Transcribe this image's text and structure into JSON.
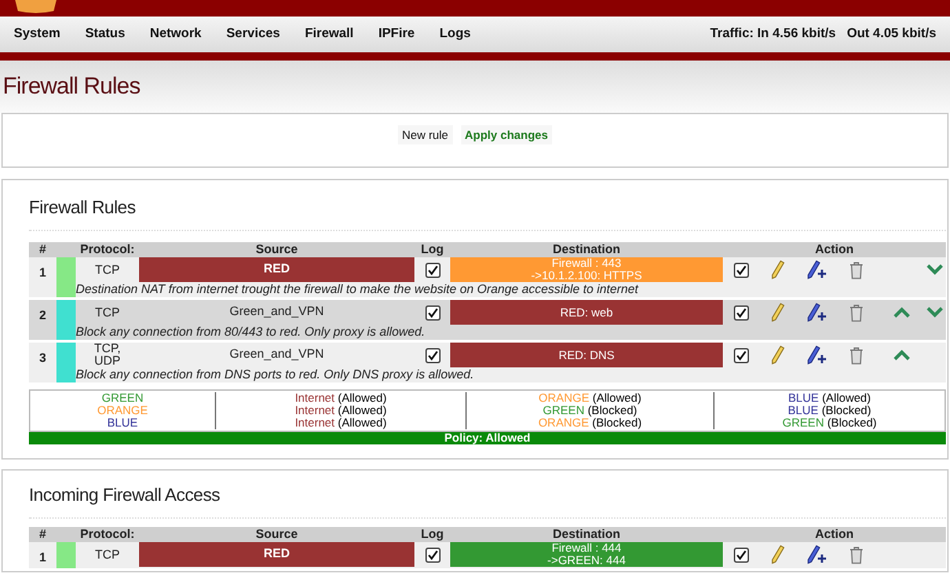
{
  "header": {
    "nav": [
      "System",
      "Status",
      "Network",
      "Services",
      "Firewall",
      "IPFire",
      "Logs"
    ],
    "traffic_in": "Traffic: In 4.56 kbit/s",
    "traffic_out": "Out 4.05 kbit/s"
  },
  "page_title": "Firewall Rules",
  "toolbar": {
    "buttons": [
      {
        "label": "New rule",
        "kind": "plain"
      },
      {
        "label": "Apply changes",
        "kind": "primary"
      }
    ]
  },
  "firewall_rules": {
    "title": "Firewall Rules",
    "columns": [
      "#",
      "Protocol:",
      "Source",
      "Log",
      "Destination",
      "Action"
    ],
    "rows": [
      {
        "number": "1",
        "color": "#86e886",
        "protocol": "TCP",
        "source": {
          "text": "RED",
          "color": "#993333"
        },
        "log": true,
        "destination": {
          "lines": [
            "Firewall : 443",
            "->10.1.2.100: HTTPS"
          ],
          "color": "#ff9933"
        },
        "enabled": true,
        "move_up": false,
        "move_down": true,
        "remark": "Destination NAT from internet trought the firewall to make the website on Orange accessible to internet"
      },
      {
        "number": "2",
        "color": "#40e0d0",
        "protocol": "TCP",
        "source": {
          "text": "Green_and_VPN"
        },
        "log": true,
        "destination": {
          "lines": [
            "RED: web"
          ],
          "color": "#993333"
        },
        "enabled": true,
        "move_up": true,
        "move_down": true,
        "remark": "Block any connection from 80/443 to red. Only proxy is allowed."
      },
      {
        "number": "3",
        "color": "#40e0d0",
        "protocol": "TCP, UDP",
        "source": {
          "text": "Green_and_VPN"
        },
        "log": true,
        "destination": {
          "lines": [
            "RED: DNS"
          ],
          "color": "#993333"
        },
        "enabled": true,
        "move_up": true,
        "move_down": false,
        "remark": "Block any connection from DNS ports to red. Only DNS proxy is allowed."
      }
    ],
    "legend": [
      [
        {
          "zone": "GREEN",
          "color": "#339933"
        },
        {
          "zone": "ORANGE",
          "color": "#ff9933"
        },
        {
          "zone": "BLUE",
          "color": "#333399"
        }
      ],
      [
        {
          "zone": "Internet",
          "color": "#993333",
          "status": "(Allowed)"
        },
        {
          "zone": "Internet",
          "color": "#993333",
          "status": "(Allowed)"
        },
        {
          "zone": "Internet",
          "color": "#993333",
          "status": "(Allowed)"
        }
      ],
      [
        {
          "zone": "ORANGE",
          "color": "#ff9933",
          "status": "(Allowed)"
        },
        {
          "zone": "GREEN",
          "color": "#339933",
          "status": "(Blocked)"
        },
        {
          "zone": "ORANGE",
          "color": "#ff9933",
          "status": "(Blocked)"
        }
      ],
      [
        {
          "zone": "BLUE",
          "color": "#333399",
          "status": "(Allowed)"
        },
        {
          "zone": "BLUE",
          "color": "#333399",
          "status": "(Blocked)"
        },
        {
          "zone": "GREEN",
          "color": "#339933",
          "status": "(Blocked)"
        }
      ]
    ],
    "policy": "Policy: Allowed"
  },
  "incoming_access": {
    "title": "Incoming Firewall Access",
    "columns": [
      "#",
      "Protocol:",
      "Source",
      "Log",
      "Destination",
      "Action"
    ],
    "rows": [
      {
        "number": "1",
        "color": "#86e886",
        "protocol": "TCP",
        "source": {
          "text": "RED",
          "color": "#993333"
        },
        "log": true,
        "destination": {
          "lines": [
            "Firewall : 444",
            "->GREEN: 444"
          ],
          "color": "#339933"
        },
        "enabled": true,
        "move_up": false,
        "move_down": false
      }
    ]
  }
}
